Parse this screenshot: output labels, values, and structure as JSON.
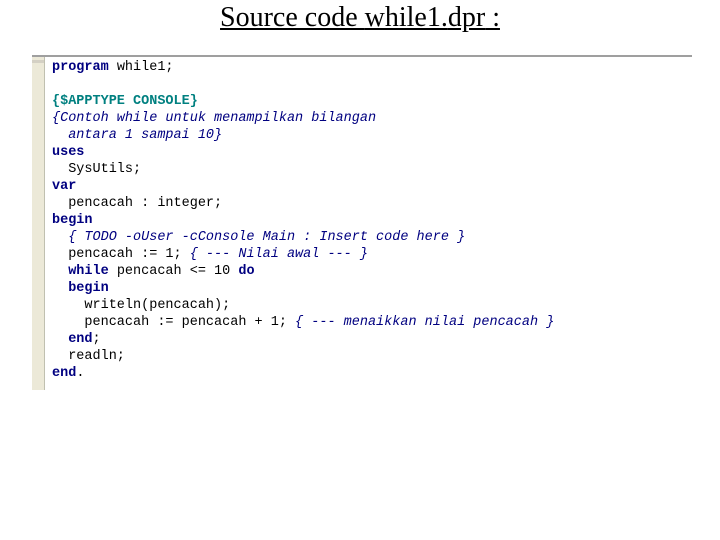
{
  "title": {
    "part1": "Source code ",
    "part2": "while1.",
    "part3": "dpr",
    "part4": " :"
  },
  "code": {
    "l1": {
      "kw": "program",
      "rest": " while1;"
    },
    "l2": "",
    "l3": {
      "dir": "{$APPTYPE CONSOLE}"
    },
    "l4": {
      "cm": "{Contoh while untuk menampilkan bilangan"
    },
    "l5": {
      "cm": "  antara 1 sampai 10}"
    },
    "l6": {
      "kw": "uses"
    },
    "l7": "  SysUtils;",
    "l8": {
      "kw": "var"
    },
    "l9": "  pencacah : integer;",
    "l10": {
      "kw": "begin"
    },
    "l11": {
      "pre": "  ",
      "cm": "{ TODO -oUser -cConsole Main : Insert code here }"
    },
    "l12": {
      "pre": "  pencacah := 1; ",
      "cm": "{ --- Nilai awal --- }"
    },
    "l13": {
      "pre": "  ",
      "kw1": "while",
      "mid": " pencacah <= 10 ",
      "kw2": "do"
    },
    "l14": {
      "pre": "  ",
      "kw": "begin"
    },
    "l15": "    writeln(pencacah);",
    "l16": {
      "pre": "    pencacah := pencacah + 1; ",
      "cm": "{ --- menaikkan nilai pencacah }"
    },
    "l17": {
      "pre": "  ",
      "kw": "end",
      "post": ";"
    },
    "l18": "  readln;",
    "l19": {
      "kw": "end",
      "post": "."
    }
  }
}
